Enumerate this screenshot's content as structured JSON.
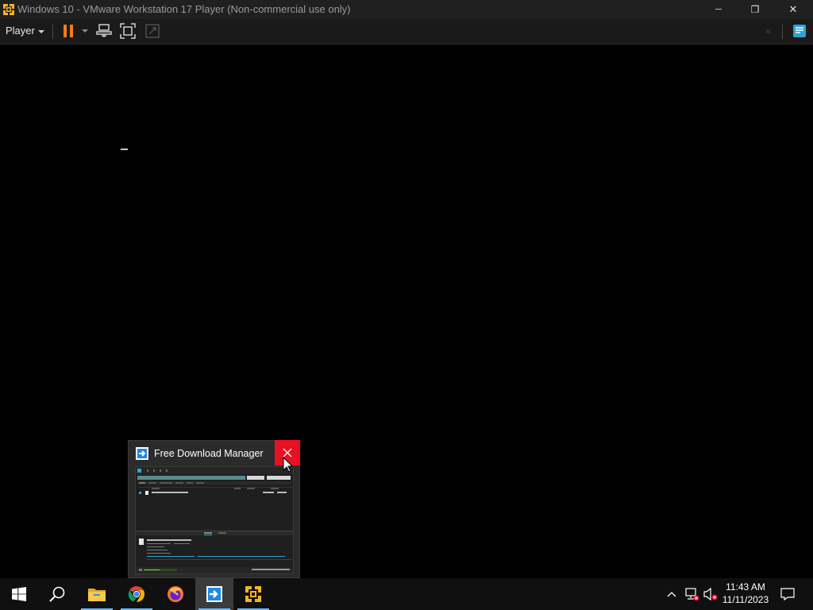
{
  "window": {
    "title": "Windows 10 - VMware Workstation 17 Player (Non-commercial use only)",
    "minimize_glyph": "─",
    "restore_glyph": "❐",
    "close_glyph": "✕"
  },
  "toolbar": {
    "player_menu_label": "Player"
  },
  "taskbar_preview": {
    "title": "Free Download Manager"
  },
  "taskbar": {
    "apps": [
      "start-icon",
      "search-icon",
      "file-explorer-icon",
      "chrome-icon",
      "firefox-icon",
      "free-download-manager-icon",
      "vmware-player-icon"
    ],
    "time": "11:43 AM",
    "date": "11/11/2023"
  },
  "colors": {
    "accent_orange": "#f47920",
    "close_red": "#e81123",
    "taskbar_indicator": "#76b9ed"
  }
}
